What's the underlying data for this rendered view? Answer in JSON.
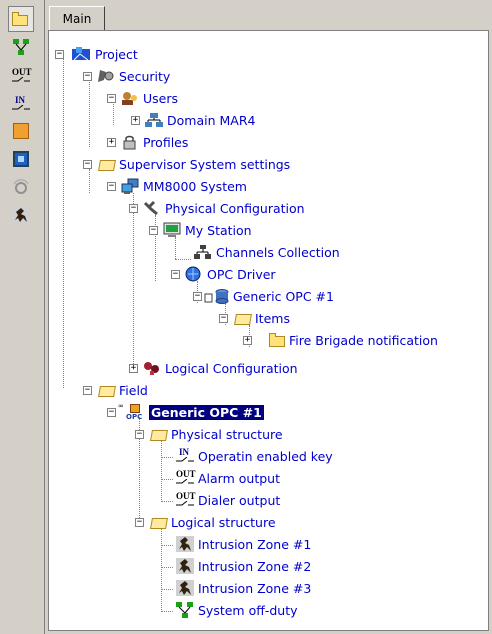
{
  "toolbar": {
    "buttons": [
      {
        "icon": "folder-icon"
      },
      {
        "icon": "network-icon"
      },
      {
        "icon": "output-icon",
        "text": "OUT"
      },
      {
        "icon": "input-icon",
        "text": "IN"
      },
      {
        "icon": "orange-square-icon"
      },
      {
        "icon": "blue-panel-icon"
      },
      {
        "icon": "siren-icon"
      },
      {
        "icon": "intruder-icon"
      }
    ]
  },
  "tabs": [
    {
      "label": "Main"
    }
  ],
  "tree": {
    "nodes": [
      {
        "label": "Project"
      },
      {
        "label": "Security"
      },
      {
        "label": "Users"
      },
      {
        "label": "Domain MAR4"
      },
      {
        "label": "Profiles"
      },
      {
        "label": "Supervisor System settings"
      },
      {
        "label": "MM8000 System"
      },
      {
        "label": "Physical Configuration"
      },
      {
        "label": "My Station"
      },
      {
        "label": "Channels Collection"
      },
      {
        "label": "OPC Driver"
      },
      {
        "label": "Generic OPC #1"
      },
      {
        "label": "Items"
      },
      {
        "label": "Fire Brigade notification"
      },
      {
        "label": "Logical Configuration"
      },
      {
        "label": "Field"
      },
      {
        "label": "Generic OPC #1"
      },
      {
        "label": "Physical structure"
      },
      {
        "label": "Operatin enabled key"
      },
      {
        "label": "Alarm output"
      },
      {
        "label": "Dialer output"
      },
      {
        "label": "Logical structure"
      },
      {
        "label": "Intrusion Zone #1"
      },
      {
        "label": "Intrusion Zone #2"
      },
      {
        "label": "Intrusion Zone #3"
      },
      {
        "label": "System off-duty"
      }
    ],
    "icon_labels": {
      "opc": "OPC",
      "in": "IN",
      "out": "OUT"
    }
  },
  "colors": {
    "label": "#0000cc",
    "selection": "#000080",
    "folder": "#ffe27a"
  }
}
